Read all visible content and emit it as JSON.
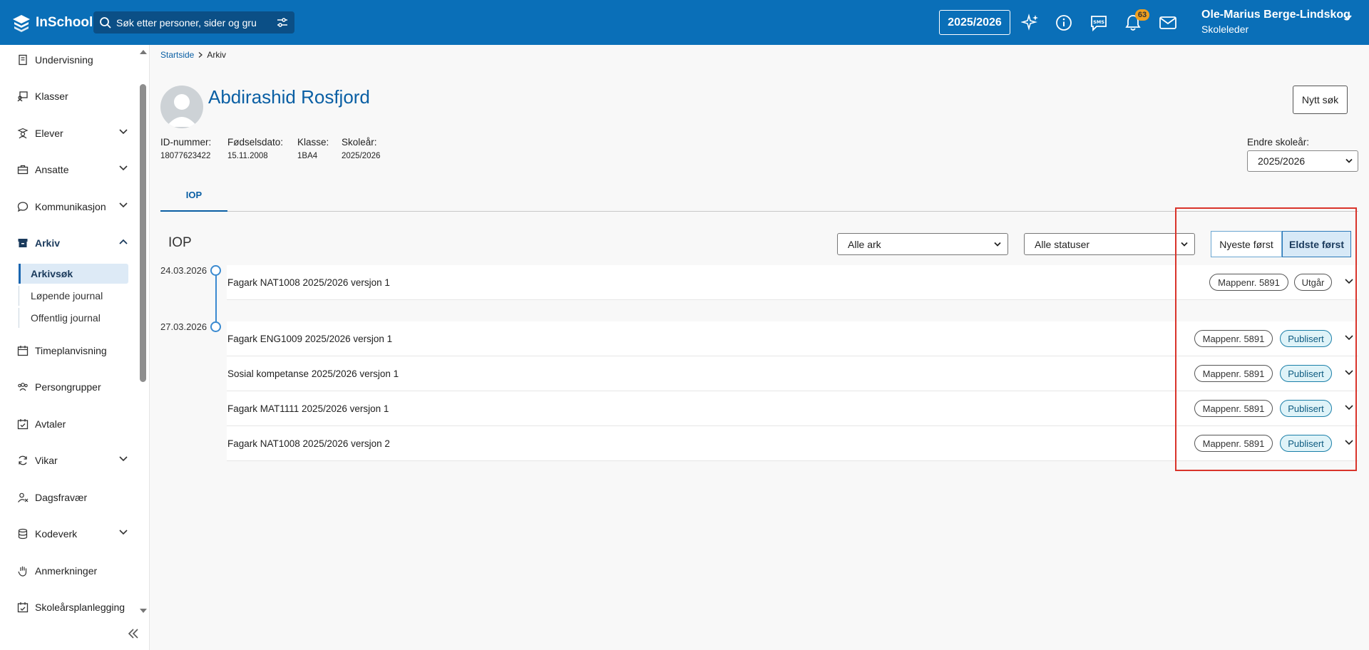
{
  "header": {
    "logo_text": "InSchool",
    "search_placeholder": "Søk etter personer, sider og gru",
    "year": "2025/2026",
    "notification_count": "63",
    "user_name": "Ole-Marius Berge-Lindskog",
    "user_role": "Skoleleder"
  },
  "sidebar": {
    "items": [
      {
        "label": "Undervisning"
      },
      {
        "label": "Klasser"
      },
      {
        "label": "Elever"
      },
      {
        "label": "Ansatte"
      },
      {
        "label": "Kommunikasjon"
      },
      {
        "label": "Arkiv"
      },
      {
        "label": "Timeplanvisning"
      },
      {
        "label": "Persongrupper"
      },
      {
        "label": "Avtaler"
      },
      {
        "label": "Vikar"
      },
      {
        "label": "Dagsfravær"
      },
      {
        "label": "Kodeverk"
      },
      {
        "label": "Anmerkninger"
      },
      {
        "label": "Skoleårsplanlegging"
      }
    ],
    "arkiv_sub": [
      {
        "label": "Arkivsøk"
      },
      {
        "label": "Løpende journal"
      },
      {
        "label": "Offentlig journal"
      }
    ]
  },
  "breadcrumb": {
    "home": "Startside",
    "current": "Arkiv"
  },
  "person": {
    "name": "Abdirashid Rosfjord",
    "id_label": "ID-nummer:",
    "id_value": "18077623422",
    "dob_label": "Fødselsdato:",
    "dob_value": "15.11.2008",
    "class_label": "Klasse:",
    "class_value": "1BA4",
    "year_label": "Skoleår:",
    "year_value": "2025/2026"
  },
  "actions": {
    "new_search": "Nytt søk"
  },
  "year_selector": {
    "label": "Endre skoleår:",
    "value": "2025/2026"
  },
  "tabs": [
    {
      "label": "IOP"
    }
  ],
  "iop": {
    "title": "IOP",
    "filter_sheets": "Alle ark",
    "filter_status": "Alle statuser",
    "sort_newest": "Nyeste først",
    "sort_oldest": "Eldste først",
    "groups": [
      {
        "date": "24.03.2026",
        "rows": [
          {
            "title": "Fagark NAT1008 2025/2026 versjon 1",
            "folder": "Mappenr. 5891",
            "status": "Utgår"
          }
        ]
      },
      {
        "date": "27.03.2026",
        "rows": [
          {
            "title": "Fagark ENG1009 2025/2026 versjon 1",
            "folder": "Mappenr. 5891",
            "status": "Publisert"
          },
          {
            "title": "Sosial kompetanse 2025/2026 versjon 1",
            "folder": "Mappenr. 5891",
            "status": "Publisert"
          },
          {
            "title": "Fagark MAT1111 2025/2026 versjon 1",
            "folder": "Mappenr. 5891",
            "status": "Publisert"
          },
          {
            "title": "Fagark NAT1008 2025/2026 versjon 2",
            "folder": "Mappenr. 5891",
            "status": "Publisert"
          }
        ]
      }
    ]
  },
  "colors": {
    "brand": "#0a6fb8",
    "link": "#0a5fa4",
    "highlight": "#d9342b",
    "published": "#dff3f8"
  }
}
